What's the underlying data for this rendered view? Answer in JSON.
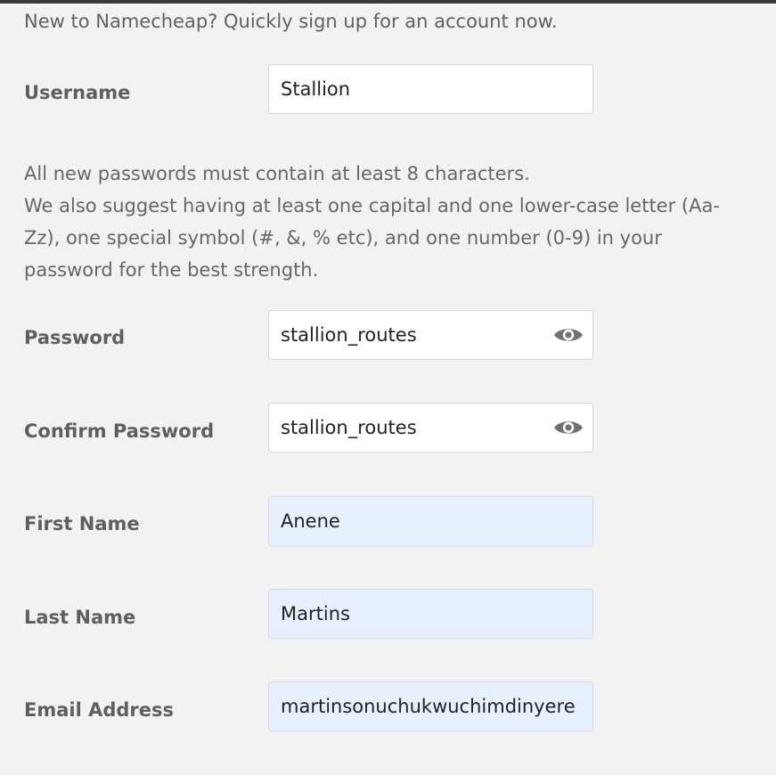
{
  "intro_text": "New to Namecheap? Quickly sign up for an account now.",
  "username": {
    "label": "Username",
    "value": "Stallion"
  },
  "password_note": {
    "line1": "All new passwords must contain at least 8 characters.",
    "line2": "We also suggest having at least one capital and one lower-case letter (Aa-Zz), one special symbol (#, &, % etc), and one number (0-9) in your password for the best strength."
  },
  "password": {
    "label": "Password",
    "value": "stallion_routes",
    "toggle_icon": "eye-icon"
  },
  "confirm_password": {
    "label": "Confirm Password",
    "value": "stallion_routes",
    "toggle_icon": "eye-icon"
  },
  "first_name": {
    "label": "First Name",
    "value": "Anene"
  },
  "last_name": {
    "label": "Last Name",
    "value": "Martins"
  },
  "email": {
    "label": "Email Address",
    "value": "martinsonuchukwuchimdinyere"
  },
  "colors": {
    "background": "#f2f2f2",
    "autofill_background": "#e8f0fe",
    "label_text": "#5f5f5f"
  }
}
